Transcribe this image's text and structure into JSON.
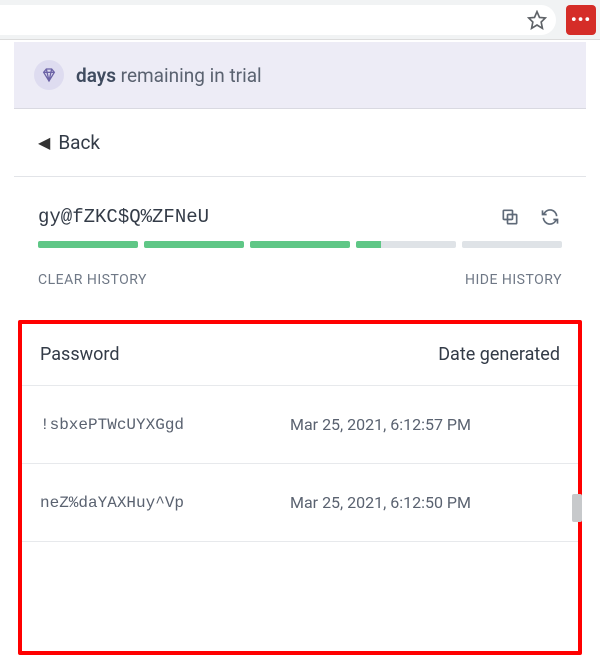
{
  "browser": {
    "extension_glyph": "•••"
  },
  "trial": {
    "bold": "days",
    "rest": " remaining in trial"
  },
  "back": {
    "label": "Back"
  },
  "generator": {
    "password": "gy@fZKC$Q%ZFNeU"
  },
  "history_actions": {
    "clear": "CLEAR HISTORY",
    "hide": "HIDE HISTORY"
  },
  "history_table": {
    "header_password": "Password",
    "header_date": "Date generated",
    "rows": [
      {
        "password": "!sbxePTWcUYXGgd",
        "date": "Mar 25, 2021, 6:12:57 PM"
      },
      {
        "password": "neZ%daYAXHuy^Vp",
        "date": "Mar 25, 2021, 6:12:50 PM"
      }
    ]
  }
}
